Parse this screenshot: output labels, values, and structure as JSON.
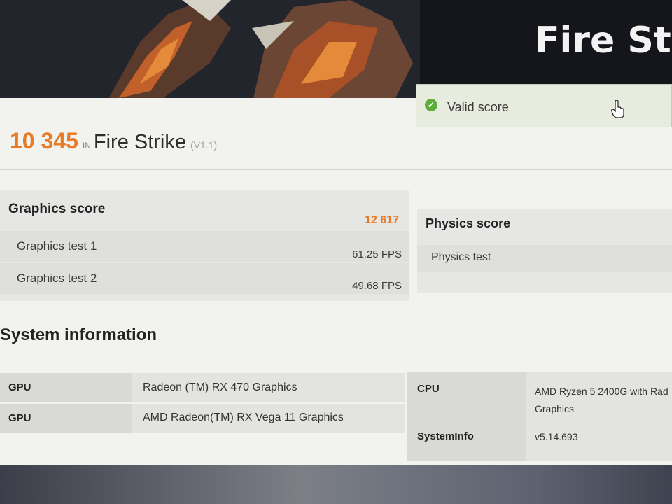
{
  "app": {
    "hero_title": "Fire Strike"
  },
  "validity": {
    "label": "Valid score",
    "status_color": "#5fae3c"
  },
  "result": {
    "score": "10 345",
    "in_label": "IN",
    "test_name": "Fire Strike",
    "version": "(V1.1)",
    "accent_color": "#e87a25"
  },
  "graphics": {
    "title": "Graphics score",
    "score": "12 617",
    "tests": [
      {
        "label": "Graphics test 1",
        "value": "61.25 FPS"
      },
      {
        "label": "Graphics test 2",
        "value": "49.68 FPS"
      }
    ]
  },
  "physics": {
    "title": "Physics score",
    "tests": [
      {
        "label": "Physics test"
      }
    ]
  },
  "system": {
    "title": "System information",
    "left_rows": [
      {
        "key": "GPU",
        "value": "Radeon (TM) RX 470 Graphics"
      },
      {
        "key": "GPU",
        "value": "AMD Radeon(TM) RX Vega 11 Graphics"
      }
    ],
    "right_rows": [
      {
        "key": "CPU",
        "value_line1": "AMD Ryzen 5 2400G with Rad",
        "value_line2": "Graphics"
      },
      {
        "key": "SystemInfo",
        "value": "v5.14.693"
      }
    ]
  },
  "icons": {
    "valid": "check-circle-icon",
    "cursor": "hand-cursor-icon"
  }
}
